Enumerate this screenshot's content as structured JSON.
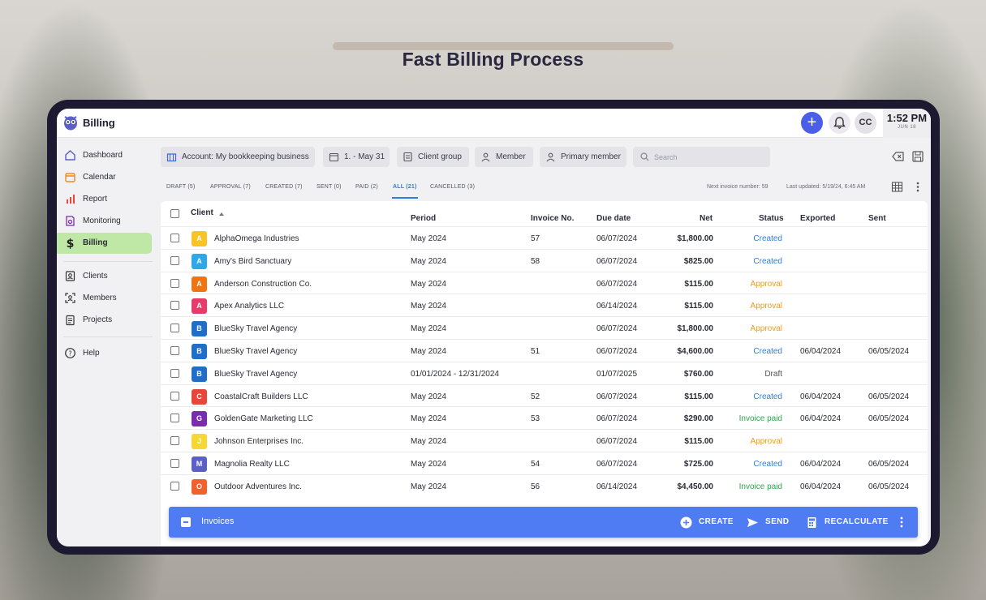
{
  "headline": "Fast Billing Process",
  "app": {
    "title": "Billing",
    "avatar_initials": "CC",
    "clock_time": "1:52 PM",
    "clock_date": "JUN 18"
  },
  "sidebar": {
    "items": [
      {
        "label": "Dashboard",
        "icon": "home-icon"
      },
      {
        "label": "Calendar",
        "icon": "calendar-icon"
      },
      {
        "label": "Report",
        "icon": "bar-chart-icon"
      },
      {
        "label": "Monitoring",
        "icon": "monitoring-icon"
      },
      {
        "label": "Billing",
        "icon": "dollar-icon",
        "active": true
      },
      {
        "label": "Clients",
        "icon": "contact-icon"
      },
      {
        "label": "Members",
        "icon": "members-icon"
      },
      {
        "label": "Projects",
        "icon": "clipboard-icon"
      },
      {
        "label": "Help",
        "icon": "help-icon"
      }
    ]
  },
  "filters": {
    "account": "Account: My bookkeeping business",
    "date": "1. - May 31",
    "client_group": "Client group",
    "member": "Member",
    "primary_member": "Primary member",
    "search_placeholder": "Search"
  },
  "tabs": [
    "DRAFT (5)",
    "APPROVAL (7)",
    "CREATED (7)",
    "SENT (0)",
    "PAID (2)",
    "ALL (21)",
    "CANCELLED (3)"
  ],
  "active_tab": "ALL (21)",
  "meta": {
    "next_invoice": "Next invoice number: 59",
    "last_updated": "Last updated: 5/19/24, 6:45 AM"
  },
  "table": {
    "headers": {
      "client": "Client",
      "period": "Period",
      "invoice_no": "Invoice No.",
      "due_date": "Due date",
      "net": "Net",
      "status": "Status",
      "exported": "Exported",
      "sent": "Sent"
    },
    "rows": [
      {
        "initial": "A",
        "color": "#f7c325",
        "client": "AlphaOmega Industries",
        "period": "May 2024",
        "invoice_no": "57",
        "due_date": "06/07/2024",
        "net": "$1,800.00",
        "status": "Created",
        "status_type": "created",
        "exported": "",
        "sent": ""
      },
      {
        "initial": "A",
        "color": "#2fa8e8",
        "client": "Amy's Bird Sanctuary",
        "period": "May 2024",
        "invoice_no": "58",
        "due_date": "06/07/2024",
        "net": "$825.00",
        "status": "Created",
        "status_type": "created",
        "exported": "",
        "sent": ""
      },
      {
        "initial": "A",
        "color": "#ef7512",
        "client": "Anderson Construction Co.",
        "period": "May 2024",
        "invoice_no": "",
        "due_date": "06/07/2024",
        "net": "$115.00",
        "status": "Approval",
        "status_type": "approval",
        "exported": "",
        "sent": ""
      },
      {
        "initial": "A",
        "color": "#e63b6b",
        "client": "Apex Analytics LLC",
        "period": "May 2024",
        "invoice_no": "",
        "due_date": "06/14/2024",
        "net": "$115.00",
        "status": "Approval",
        "status_type": "approval",
        "exported": "",
        "sent": ""
      },
      {
        "initial": "B",
        "color": "#1f6fc9",
        "client": "BlueSky Travel Agency",
        "period": "May 2024",
        "invoice_no": "",
        "due_date": "06/07/2024",
        "net": "$1,800.00",
        "status": "Approval",
        "status_type": "approval",
        "exported": "",
        "sent": ""
      },
      {
        "initial": "B",
        "color": "#1f6fc9",
        "client": "BlueSky Travel Agency",
        "period": "May 2024",
        "invoice_no": "51",
        "due_date": "06/07/2024",
        "net": "$4,600.00",
        "status": "Created",
        "status_type": "created",
        "exported": "06/04/2024",
        "sent": "06/05/2024"
      },
      {
        "initial": "B",
        "color": "#1f6fc9",
        "client": "BlueSky Travel Agency",
        "period": "01/01/2024 - 12/31/2024",
        "invoice_no": "",
        "due_date": "01/07/2025",
        "net": "$760.00",
        "status": "Draft",
        "status_type": "draft",
        "exported": "",
        "sent": ""
      },
      {
        "initial": "C",
        "color": "#e9463b",
        "client": "CoastalCraft Builders LLC",
        "period": "May 2024",
        "invoice_no": "52",
        "due_date": "06/07/2024",
        "net": "$115.00",
        "status": "Created",
        "status_type": "created",
        "exported": "06/04/2024",
        "sent": "06/05/2024"
      },
      {
        "initial": "G",
        "color": "#7a2bb0",
        "client": "GoldenGate Marketing LLC",
        "period": "May 2024",
        "invoice_no": "53",
        "due_date": "06/07/2024",
        "net": "$290.00",
        "status": "Invoice paid",
        "status_type": "paid",
        "exported": "06/04/2024",
        "sent": "06/05/2024"
      },
      {
        "initial": "J",
        "color": "#f7d733",
        "client": "Johnson Enterprises Inc.",
        "period": "May 2024",
        "invoice_no": "",
        "due_date": "06/07/2024",
        "net": "$115.00",
        "status": "Approval",
        "status_type": "approval",
        "exported": "",
        "sent": ""
      },
      {
        "initial": "M",
        "color": "#5b5fc7",
        "client": "Magnolia Realty LLC",
        "period": "May 2024",
        "invoice_no": "54",
        "due_date": "06/07/2024",
        "net": "$725.00",
        "status": "Created",
        "status_type": "created",
        "exported": "06/04/2024",
        "sent": "06/05/2024"
      },
      {
        "initial": "O",
        "color": "#f2612b",
        "client": "Outdoor Adventures Inc.",
        "period": "May 2024",
        "invoice_no": "56",
        "due_date": "06/14/2024",
        "net": "$4,450.00",
        "status": "Invoice paid",
        "status_type": "paid",
        "exported": "06/04/2024",
        "sent": "06/05/2024"
      }
    ]
  },
  "action_bar": {
    "title": "Invoices",
    "create": "CREATE",
    "send": "SEND",
    "recalculate": "RECALCULATE"
  }
}
